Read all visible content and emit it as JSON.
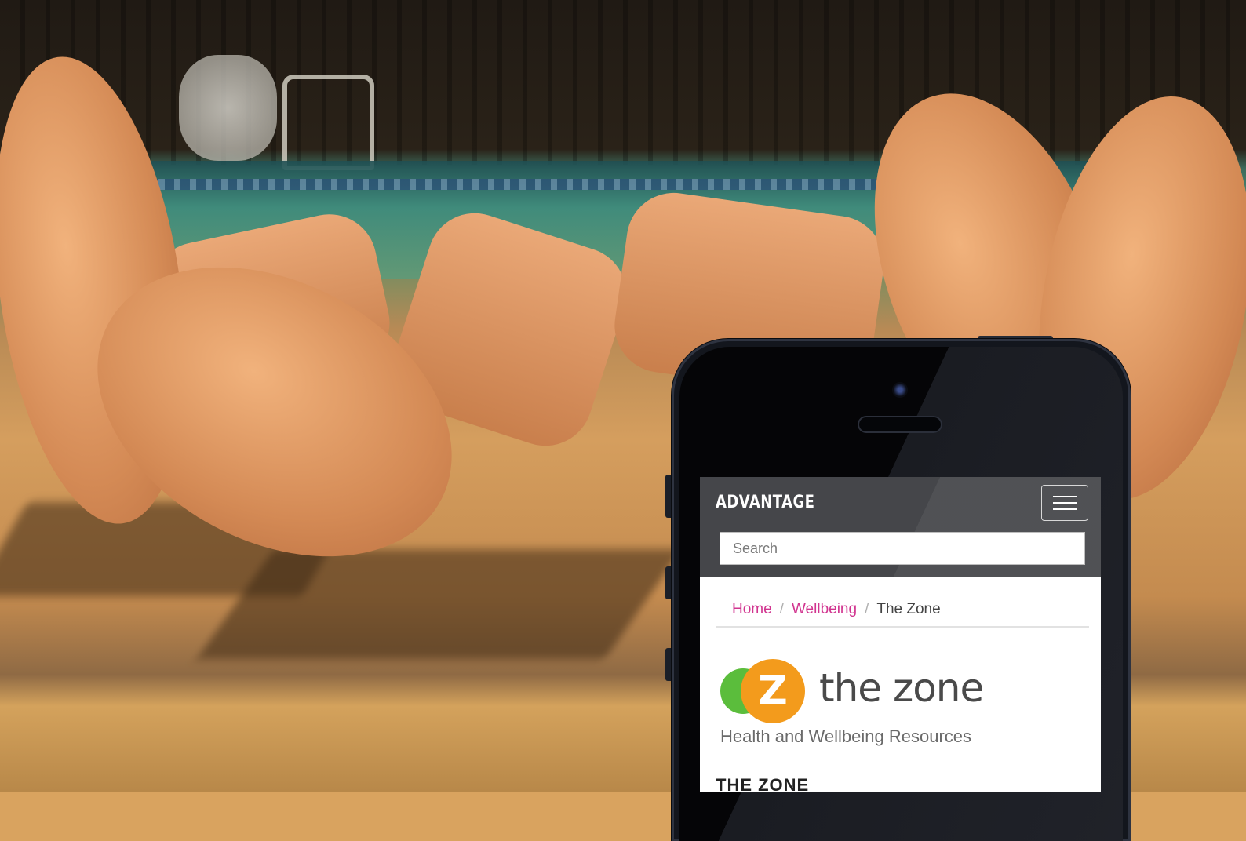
{
  "site": {
    "brand": "ADVANTAGE",
    "search_placeholder": "Search"
  },
  "breadcrumb": {
    "items": [
      {
        "label": "Home"
      },
      {
        "label": "Wellbeing"
      },
      {
        "label": "The Zone"
      }
    ],
    "separator": "/"
  },
  "logo": {
    "mark_letter": "Z",
    "wordmark": "the zone",
    "tagline": "Health and Wellbeing Resources"
  },
  "content": {
    "heading": "THE ZONE"
  },
  "colors": {
    "nav_bg": "#45464a",
    "link": "#d1348f",
    "logo_orange": "#f39b1c",
    "logo_green": "#5bbd3c"
  },
  "icons": {
    "menu": "hamburger-icon"
  }
}
